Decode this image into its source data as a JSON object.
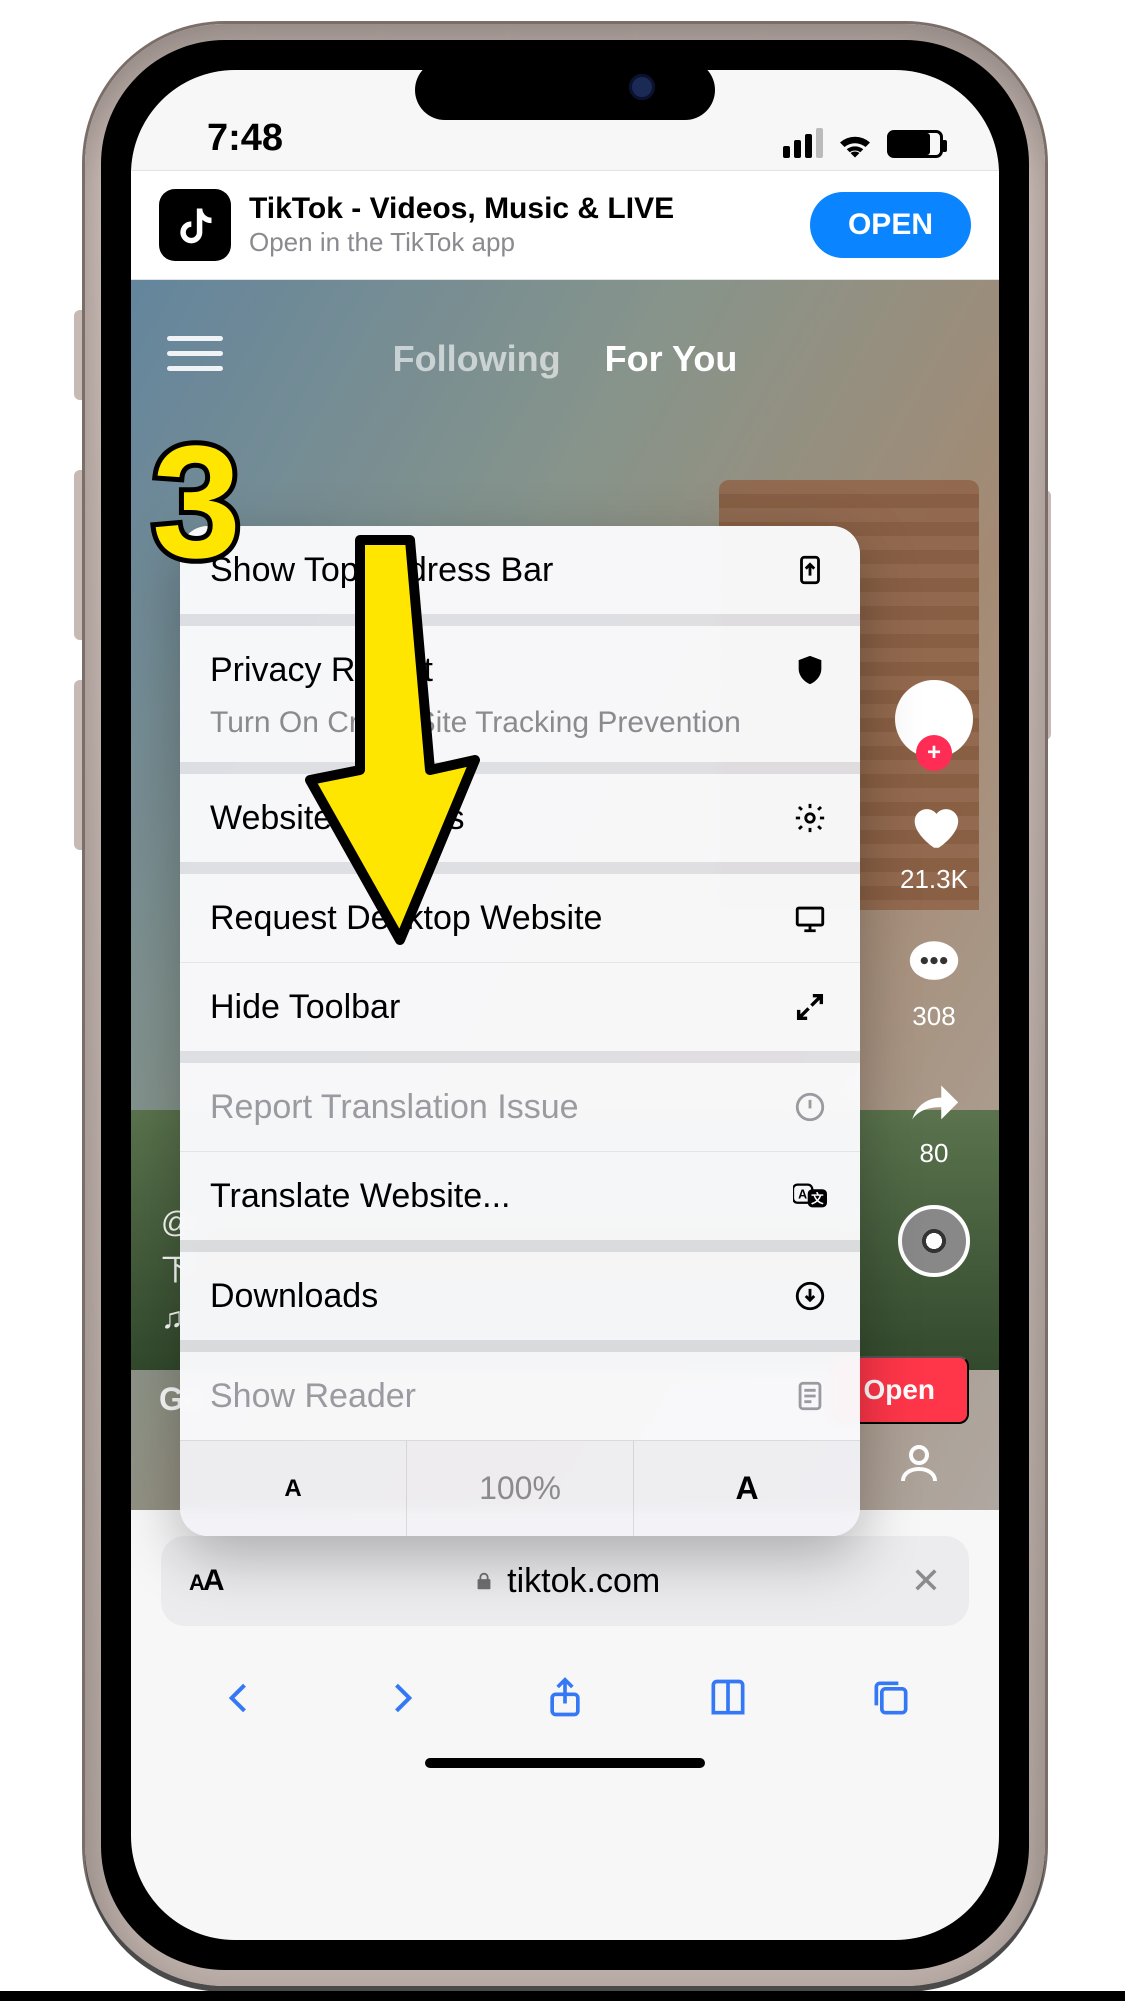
{
  "statusbar": {
    "time": "7:48"
  },
  "app_banner": {
    "title": "TikTok - Videos, Music & LIVE",
    "subtitle": "Open in the TikTok app",
    "button": "OPEN"
  },
  "tiktok": {
    "tabs": {
      "following": "Following",
      "for_you": "For You"
    },
    "metrics": {
      "likes": "21.3K",
      "comments": "308",
      "shares": "80"
    },
    "caption_user": "@r",
    "open_button": "Open",
    "get_app": "Ge"
  },
  "aa_menu": {
    "show_top": "Show Top Address Bar",
    "privacy": {
      "title": "Privacy Report",
      "sub": "Turn On Cross-Site Tracking Prevention"
    },
    "website_settings": "Website Settings",
    "request_desktop": "Request Desktop Website",
    "hide_toolbar": "Hide Toolbar",
    "report_translation": "Report Translation Issue",
    "translate": "Translate Website...",
    "downloads": "Downloads",
    "show_reader": "Show Reader",
    "zoom": {
      "dec": "A",
      "pct": "100%",
      "inc": "A"
    }
  },
  "safari": {
    "aa": "AA",
    "lock": "🔒",
    "domain": "tiktok.com"
  },
  "annotation": {
    "step": "3"
  }
}
